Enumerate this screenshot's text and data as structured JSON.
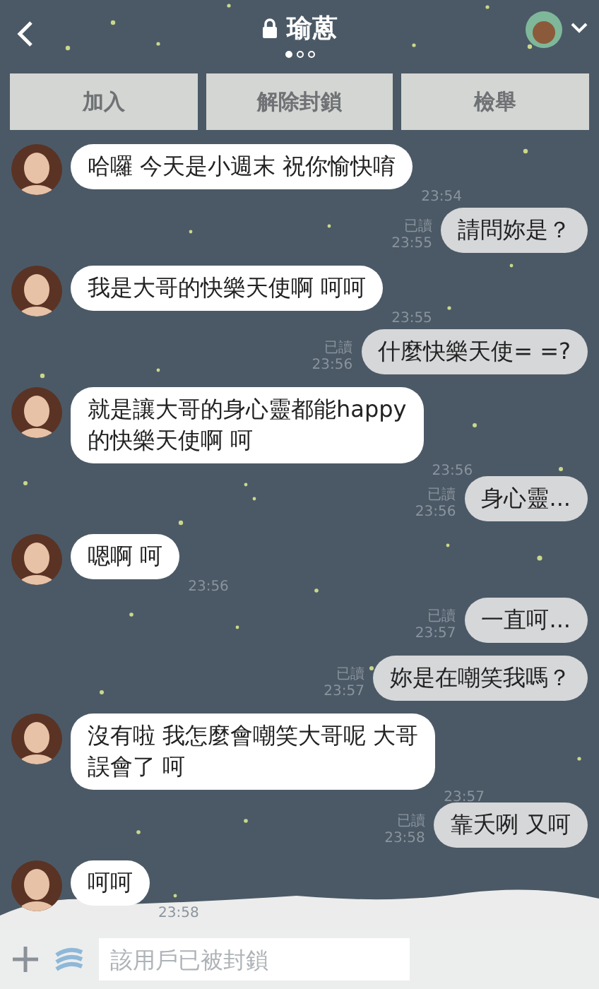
{
  "header": {
    "title": "瑜蒽",
    "page_dots": [
      {
        "selected": true
      },
      {
        "selected": false
      },
      {
        "selected": false
      }
    ]
  },
  "actions": [
    "加入",
    "解除封鎖",
    "檢舉"
  ],
  "messages": [
    {
      "kind": "received",
      "lines": [
        "哈囉 今天是小週末 祝你愉快唷"
      ],
      "time": "23:54"
    },
    {
      "kind": "sent",
      "lines": [
        "請問妳是？"
      ],
      "read": "已讀",
      "time": "23:55"
    },
    {
      "kind": "received",
      "lines": [
        "我是大哥的快樂天使啊 呵呵"
      ],
      "time": "23:55"
    },
    {
      "kind": "sent",
      "lines": [
        "什麼快樂天使= =?"
      ],
      "read": "已讀",
      "time": "23:56"
    },
    {
      "kind": "received",
      "lines": [
        "就是讓大哥的身心靈都能happy",
        "的快樂天使啊 呵"
      ],
      "time": "23:56"
    },
    {
      "kind": "sent",
      "lines": [
        "身心靈..."
      ],
      "read": "已讀",
      "time": "23:56"
    },
    {
      "kind": "received",
      "lines": [
        "嗯啊 呵"
      ],
      "time": "23:56"
    },
    {
      "kind": "sent",
      "lines": [
        "一直呵..."
      ],
      "read": "已讀",
      "time": "23:57"
    },
    {
      "kind": "sent",
      "lines": [
        "妳是在嘲笑我嗎？"
      ],
      "read": "已讀",
      "time": "23:57"
    },
    {
      "kind": "received",
      "lines": [
        "沒有啦 我怎麼會嘲笑大哥呢 大哥",
        "誤會了 呵"
      ],
      "time": "23:57"
    },
    {
      "kind": "sent",
      "lines": [
        "靠夭咧 又呵"
      ],
      "read": "已讀",
      "time": "23:58"
    },
    {
      "kind": "received",
      "lines": [
        "呵呵"
      ],
      "time": "23:58"
    }
  ],
  "input": {
    "placeholder": "該用戶已被封鎖"
  }
}
